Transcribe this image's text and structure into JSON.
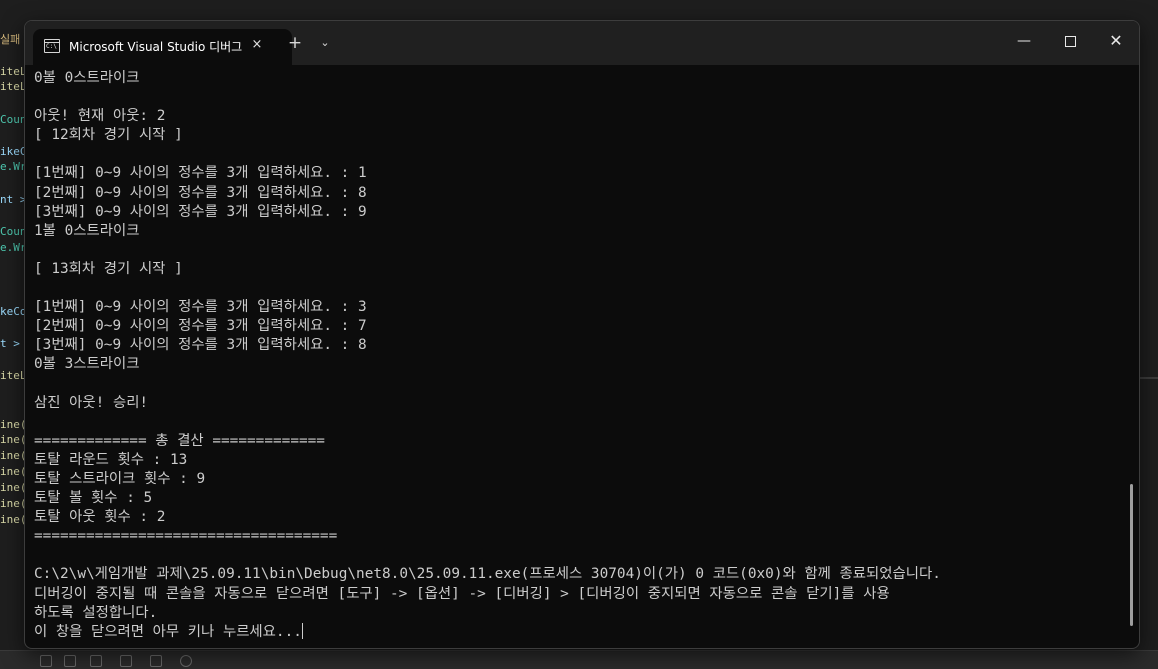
{
  "background_editor": {
    "fragments": [
      {
        "text": "실패",
        "color": "#d7ba7d"
      },
      {
        "text": "iteL",
        "color": "#dcdcaa"
      },
      {
        "text": "iteL",
        "color": "#dcdcaa"
      },
      {
        "text": "Coun",
        "color": "#4ec9b0"
      },
      {
        "text": "ikeC",
        "color": "#9cdcfe"
      },
      {
        "text": "e.Wr",
        "color": "#4ec9b0"
      },
      {
        "text": "nt >",
        "color": "#9cdcfe"
      },
      {
        "text": "Coun",
        "color": "#4ec9b0"
      },
      {
        "text": "e.Wr",
        "color": "#4ec9b0"
      },
      {
        "text": "keCo",
        "color": "#9cdcfe"
      },
      {
        "text": "t >",
        "color": "#9cdcfe"
      },
      {
        "text": "iteL",
        "color": "#dcdcaa"
      },
      {
        "text": "ine(",
        "color": "#dcdcaa"
      },
      {
        "text": "ine(",
        "color": "#dcdcaa"
      },
      {
        "text": "ine(",
        "color": "#dcdcaa"
      },
      {
        "text": "ine(",
        "color": "#dcdcaa"
      },
      {
        "text": "ine(",
        "color": "#dcdcaa"
      },
      {
        "text": "ine(",
        "color": "#dcdcaa"
      },
      {
        "text": "ine(",
        "color": "#dcdcaa"
      }
    ]
  },
  "window": {
    "tab_title": "Microsoft Visual Studio 디버그",
    "tab_icon_text": "C:\\",
    "tab_close_icon": "×",
    "new_tab_icon": "+",
    "dropdown_icon": "⌄",
    "minimize_icon": "—",
    "close_icon": "✕"
  },
  "console": {
    "lines": [
      "0볼 0스트라이크",
      "",
      "아웃! 현재 아웃: 2",
      "[ 12회차 경기 시작 ]",
      "",
      "[1번째] 0~9 사이의 정수를 3개 입력하세요. : 1",
      "[2번째] 0~9 사이의 정수를 3개 입력하세요. : 8",
      "[3번째] 0~9 사이의 정수를 3개 입력하세요. : 9",
      "1볼 0스트라이크",
      "",
      "[ 13회차 경기 시작 ]",
      "",
      "[1번째] 0~9 사이의 정수를 3개 입력하세요. : 3",
      "[2번째] 0~9 사이의 정수를 3개 입력하세요. : 7",
      "[3번째] 0~9 사이의 정수를 3개 입력하세요. : 8",
      "0볼 3스트라이크",
      "",
      "삼진 아웃! 승리!",
      "",
      "============= 총 결산 =============",
      "토탈 라운드 횟수 : 13",
      "토탈 스트라이크 횟수 : 9",
      "토탈 볼 횟수 : 5",
      "토탈 아웃 횟수 : 2",
      "===================================",
      "",
      "C:\\2\\w\\게임개발 과제\\25.09.11\\bin\\Debug\\net8.0\\25.09.11.exe(프로세스 30704)이(가) 0 코드(0x0)와 함께 종료되었습니다.",
      "디버깅이 중지될 때 콘솔을 자동으로 닫으려면 [도구] -> [옵션] -> [디버깅] > [디버깅이 중지되면 자동으로 콘솔 닫기]를 사용",
      "하도록 설정합니다.",
      "이 창을 닫으려면 아무 키나 누르세요..."
    ]
  }
}
